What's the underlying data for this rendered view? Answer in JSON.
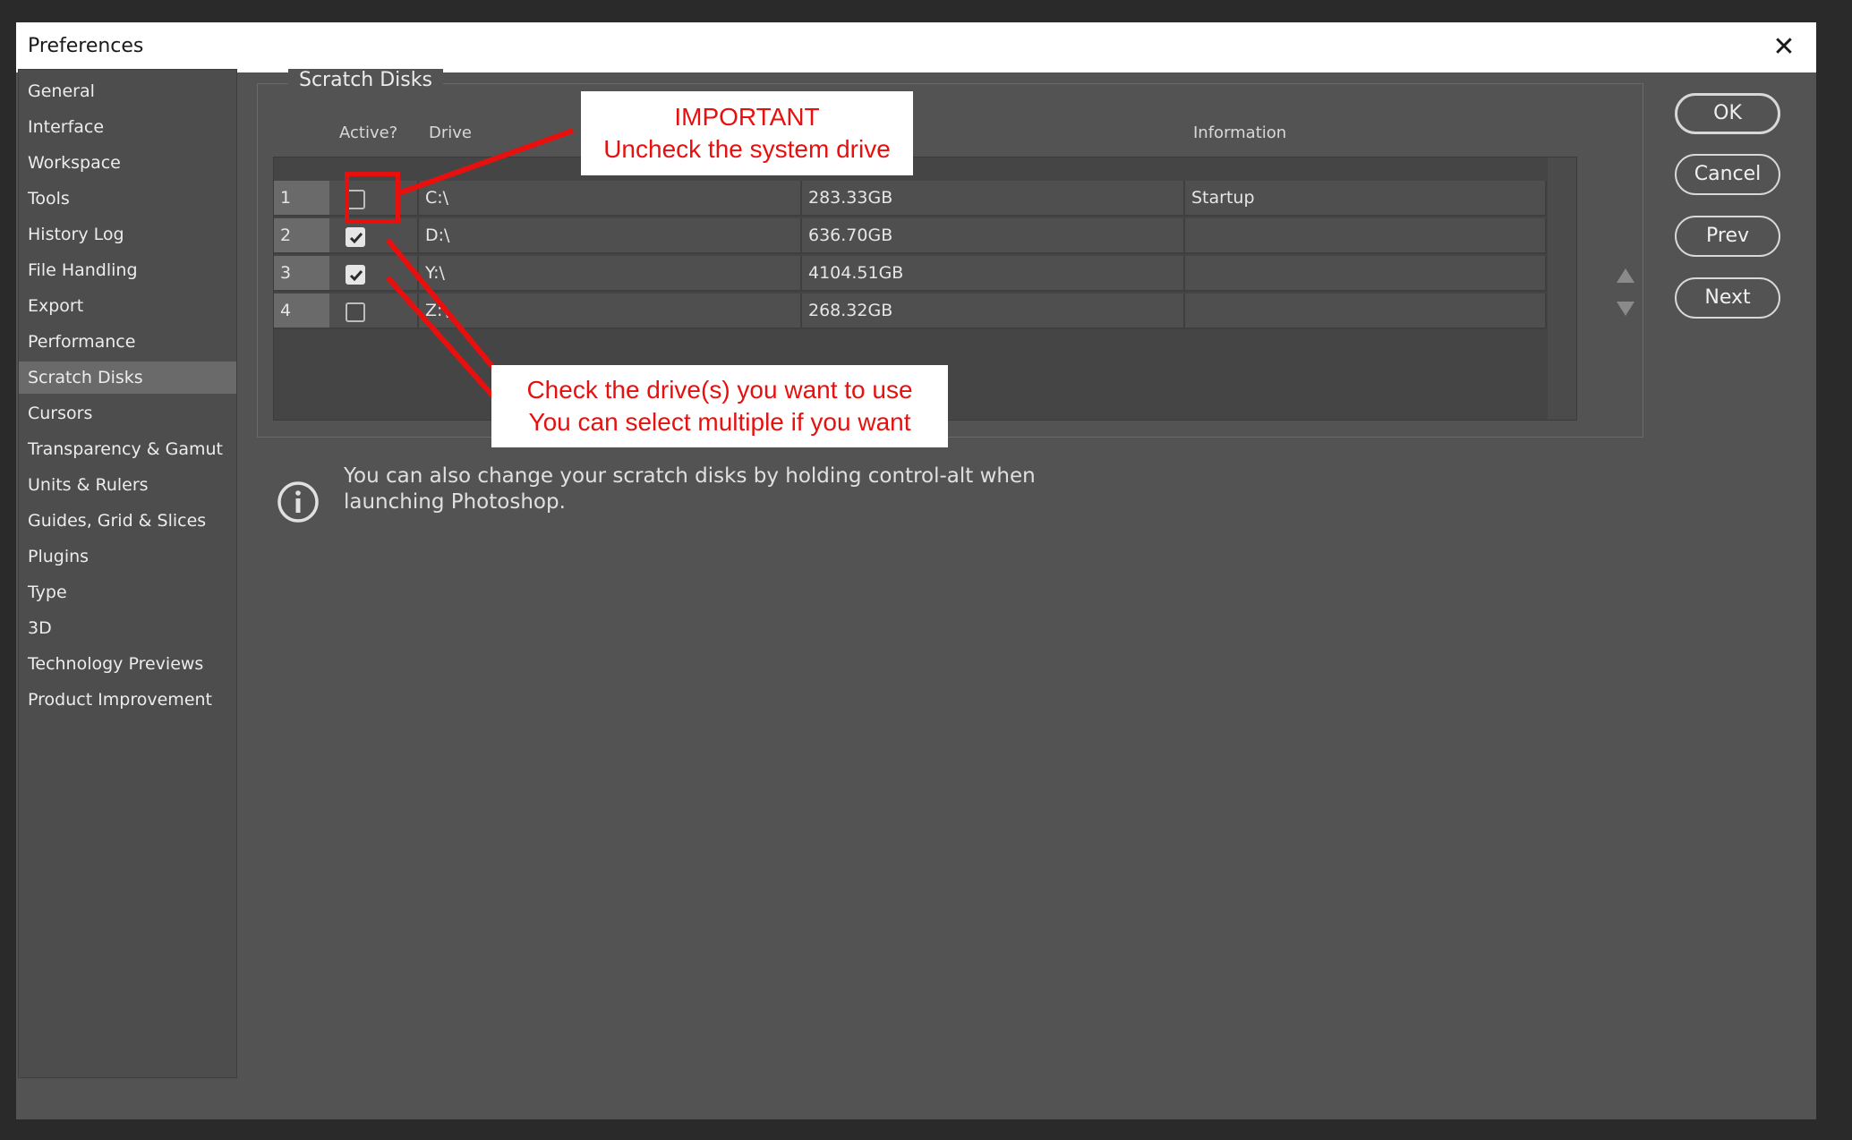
{
  "window": {
    "title": "Preferences",
    "close_label": "✕"
  },
  "sidebar": {
    "items": [
      {
        "label": "General"
      },
      {
        "label": "Interface"
      },
      {
        "label": "Workspace"
      },
      {
        "label": "Tools"
      },
      {
        "label": "History Log"
      },
      {
        "label": "File Handling"
      },
      {
        "label": "Export"
      },
      {
        "label": "Performance"
      },
      {
        "label": "Scratch Disks",
        "selected": true
      },
      {
        "label": "Cursors"
      },
      {
        "label": "Transparency & Gamut"
      },
      {
        "label": "Units & Rulers"
      },
      {
        "label": "Guides, Grid & Slices"
      },
      {
        "label": "Plugins"
      },
      {
        "label": "Type"
      },
      {
        "label": "3D"
      },
      {
        "label": "Technology Previews"
      },
      {
        "label": "Product Improvement"
      }
    ]
  },
  "scratch": {
    "title": "Scratch Disks",
    "columns": {
      "active": "Active?",
      "drive": "Drive",
      "information": "Information"
    },
    "rows": [
      {
        "num": "1",
        "active": false,
        "drive": "C:\\",
        "size": "283.33GB",
        "info": "Startup"
      },
      {
        "num": "2",
        "active": true,
        "drive": "D:\\",
        "size": "636.70GB",
        "info": ""
      },
      {
        "num": "3",
        "active": true,
        "drive": "Y:\\",
        "size": "4104.51GB",
        "info": ""
      },
      {
        "num": "4",
        "active": false,
        "drive": "Z:\\",
        "size": "268.32GB",
        "info": ""
      }
    ],
    "move_up": "▲",
    "move_down": "▼"
  },
  "buttons": {
    "ok": "OK",
    "cancel": "Cancel",
    "prev": "Prev",
    "next": "Next"
  },
  "info": {
    "text": "You can also change your scratch disks by holding control-alt when launching Photoshop."
  },
  "annotations": {
    "important_line1": "IMPORTANT",
    "important_line2": "Uncheck the system drive",
    "check_line1": "Check the drive(s) you want to use",
    "check_line2": "You can select multiple if you want"
  },
  "colors": {
    "annotation": "#e8100f",
    "dialog_bg": "#535353",
    "titlebar": "#ffffff"
  }
}
